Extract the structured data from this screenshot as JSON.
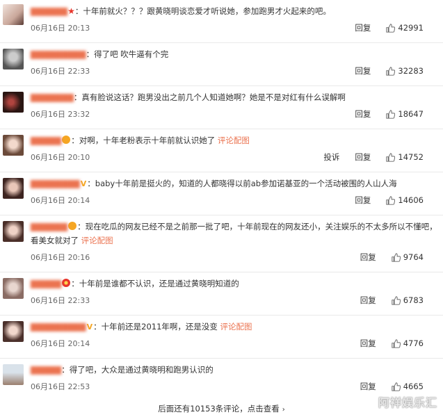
{
  "comments": [
    {
      "badge": "star",
      "text": "：十年前就火？？？跟黄晓明谈恋爱才听说她，参加跑男才火起来的吧。",
      "link": "",
      "time": "06月16日 20:13",
      "report": "",
      "reply": "回复",
      "likes": "42991"
    },
    {
      "badge": "",
      "text": "：得了吧 吹牛逼有个完",
      "link": "",
      "time": "06月16日 22:33",
      "report": "",
      "reply": "回复",
      "likes": "32283"
    },
    {
      "badge": "",
      "text": "：真有脸说这话？跑男没出之前几个人知道她啊？她是不是对红有什么误解啊",
      "link": "",
      "time": "06月16日 23:32",
      "report": "",
      "reply": "回复",
      "likes": "18647"
    },
    {
      "badge": "crown",
      "text": "：对啊，十年老粉表示十年前就认识她了",
      "link": "评论配图",
      "time": "06月16日 20:10",
      "report": "投诉",
      "reply": "回复",
      "likes": "14752"
    },
    {
      "badge": "v",
      "text": "：baby十年前是挺火的，知道的人都晓得以前ab参加诺基亚的一个活动被围的人山人海",
      "link": "",
      "time": "06月16日 20:14",
      "report": "",
      "reply": "回复",
      "likes": "14606"
    },
    {
      "badge": "crown",
      "text": "：现在吃瓜的网友已经不是之前那一批了吧，十年前现在的网友还小，关注娱乐的不太多所以不懂吧，看美女就对了",
      "link": "评论配图",
      "time": "06月16日 20:16",
      "report": "",
      "reply": "回复",
      "likes": "9764"
    },
    {
      "badge": "flower",
      "text": "：十年前是谁都不认识，还是通过黄晓明知道的",
      "link": "",
      "time": "06月16日 22:33",
      "report": "",
      "reply": "回复",
      "likes": "6783"
    },
    {
      "badge": "v",
      "text": "：十年前还是2011年啊，还是没变",
      "link": "评论配图",
      "time": "06月16日 20:14",
      "report": "",
      "reply": "回复",
      "likes": "4776"
    },
    {
      "badge": "",
      "text": "：得了吧，大众是通过黄晓明和跑男认识的",
      "link": "",
      "time": "06月16日 22:53",
      "report": "",
      "reply": "回复",
      "likes": "4665"
    }
  ],
  "footer": {
    "more_text": "后面还有10153条评论，点击查看",
    "arrow": "›"
  },
  "watermark": "阿祥娱乐汇",
  "icons": {
    "like": "thumbs-up-icon",
    "verified": "verified-v-icon"
  },
  "colors": {
    "link": "#eb7350",
    "text": "#333333",
    "time": "#666666",
    "divider": "#e9e9e9"
  }
}
